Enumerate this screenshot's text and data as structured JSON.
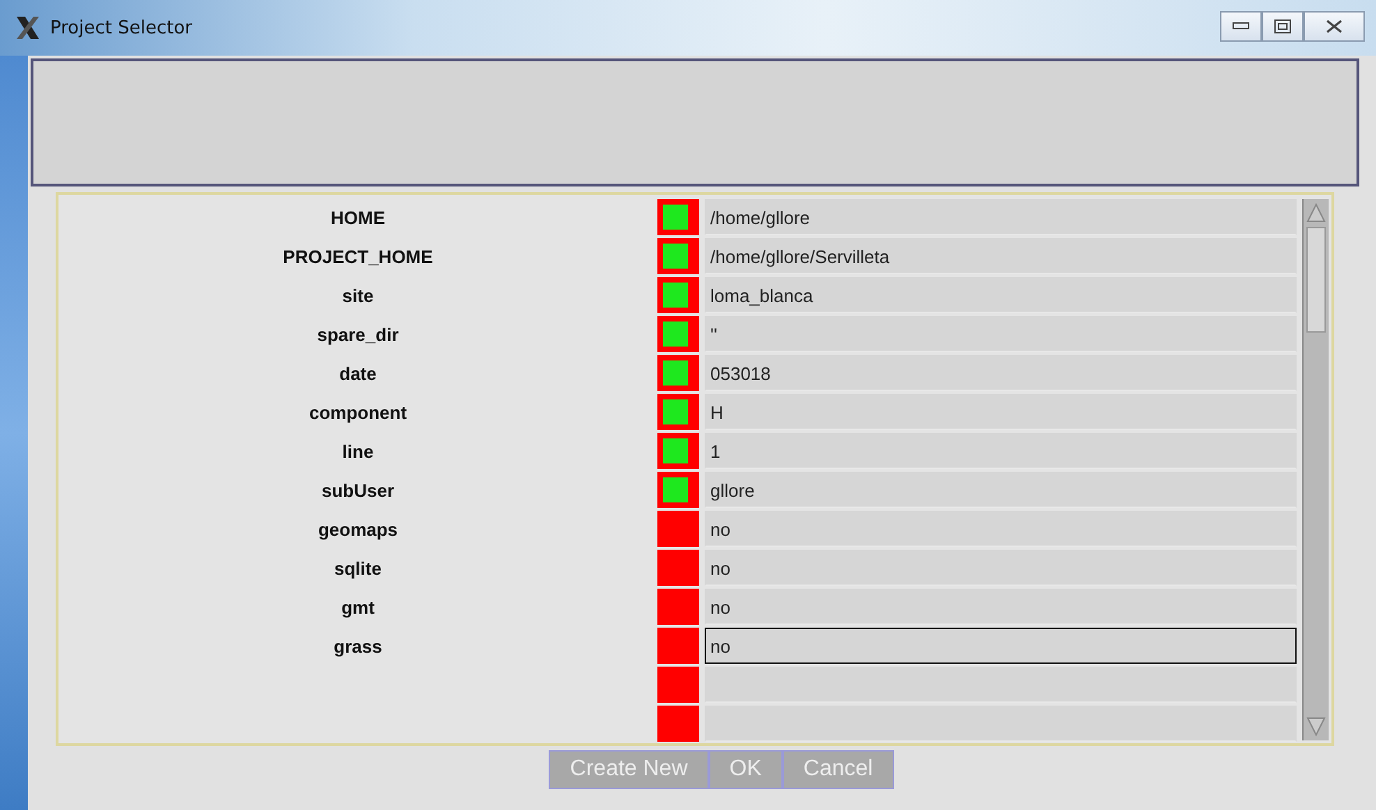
{
  "window": {
    "title": "Project Selector"
  },
  "variables": [
    {
      "name": "HOME",
      "value": "/home/gllore",
      "set": true,
      "focused": false
    },
    {
      "name": "PROJECT_HOME",
      "value": "/home/gllore/Servilleta",
      "set": true,
      "focused": false
    },
    {
      "name": "site",
      "value": "loma_blanca",
      "set": true,
      "focused": false
    },
    {
      "name": "spare_dir",
      "value": "''",
      "set": true,
      "focused": false
    },
    {
      "name": "date",
      "value": "053018",
      "set": true,
      "focused": false
    },
    {
      "name": "component",
      "value": "H",
      "set": true,
      "focused": false
    },
    {
      "name": "line",
      "value": "1",
      "set": true,
      "focused": false
    },
    {
      "name": "subUser",
      "value": "gllore",
      "set": true,
      "focused": false
    },
    {
      "name": "geomaps",
      "value": "no",
      "set": false,
      "focused": false
    },
    {
      "name": "sqlite",
      "value": "no",
      "set": false,
      "focused": false
    },
    {
      "name": "gmt",
      "value": "no",
      "set": false,
      "focused": false
    },
    {
      "name": "grass",
      "value": "no",
      "set": false,
      "focused": true
    },
    {
      "set": false,
      "focused": false
    },
    {
      "set": false,
      "focused": false
    }
  ],
  "buttons": [
    "Create New",
    "OK",
    "Cancel"
  ]
}
